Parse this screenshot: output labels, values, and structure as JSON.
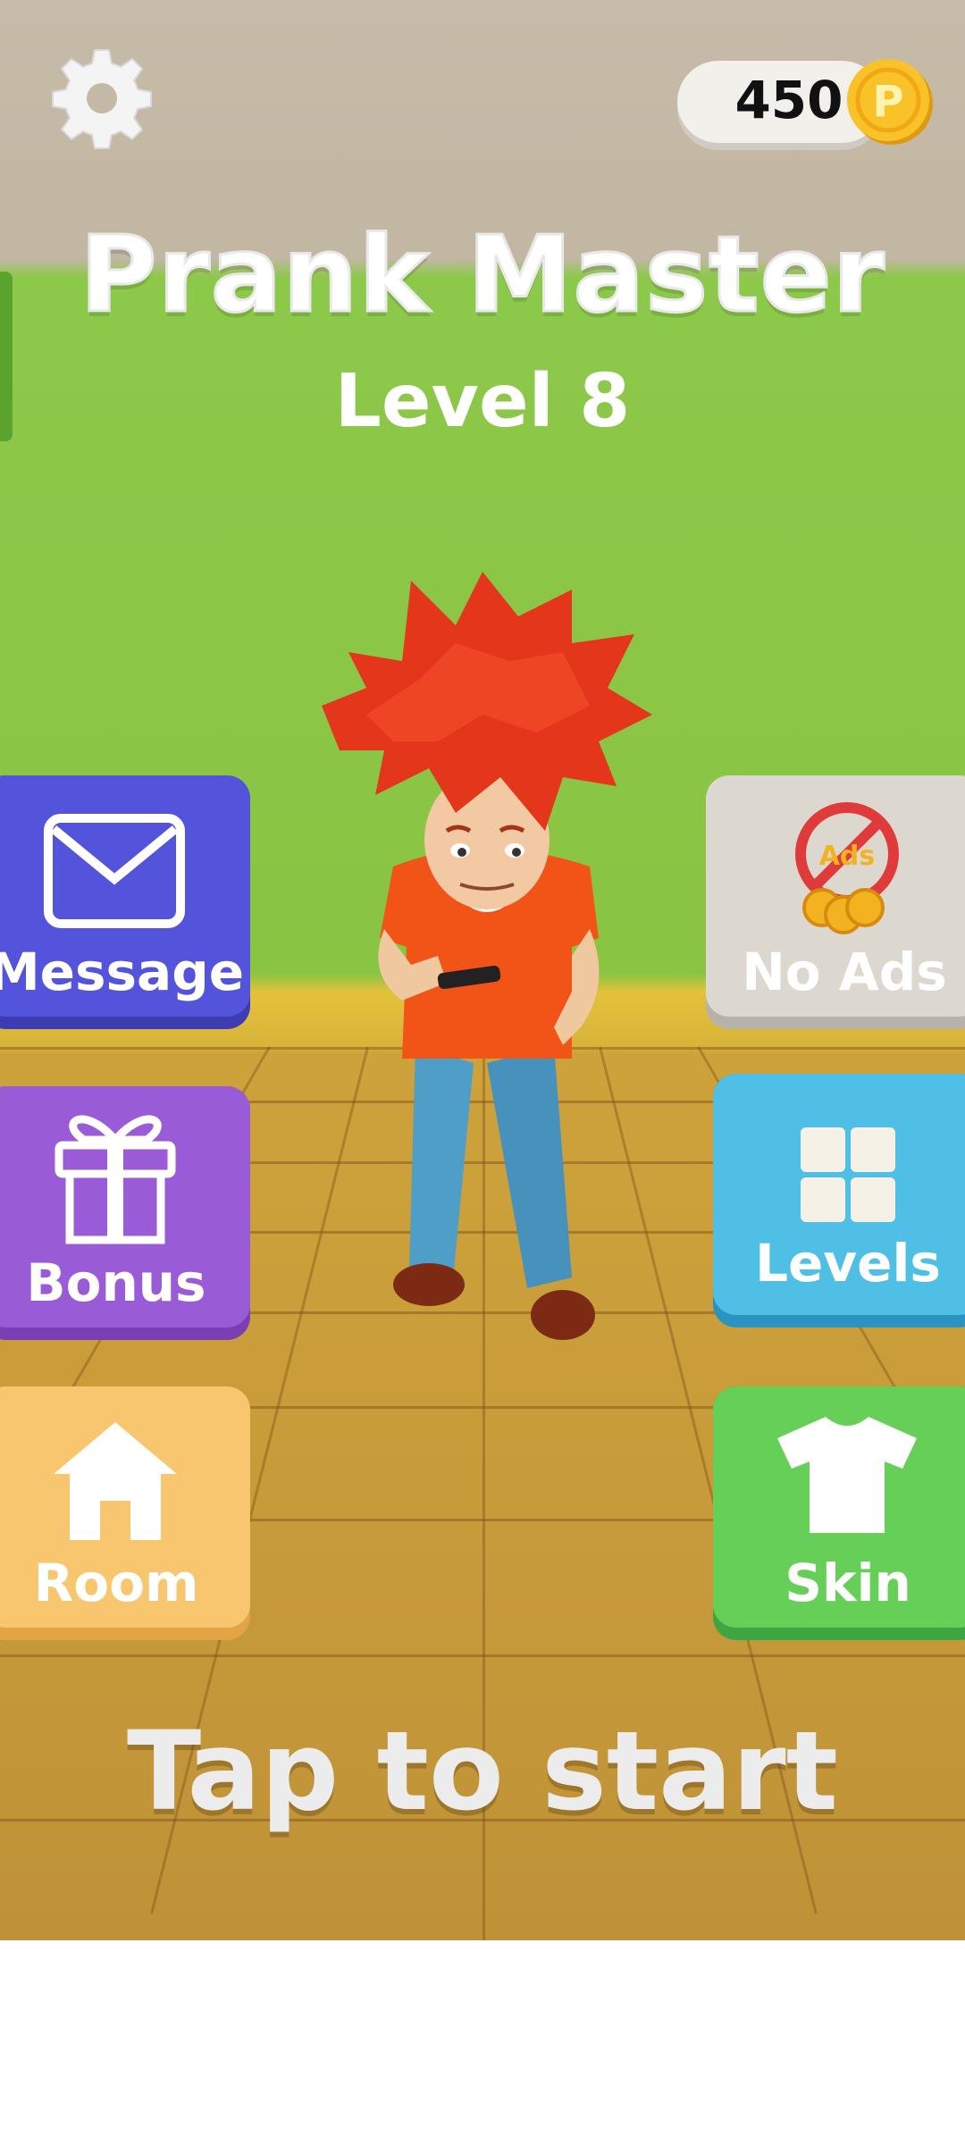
{
  "header": {
    "coin_count": "450",
    "coin_symbol": "P"
  },
  "title": {
    "app_name": "Prank Master",
    "level": "Level 8"
  },
  "left_buttons": [
    {
      "label": "Message",
      "icon": "envelope-icon"
    },
    {
      "label": "Bonus",
      "icon": "gift-icon"
    },
    {
      "label": "Room",
      "icon": "house-icon"
    }
  ],
  "right_buttons": [
    {
      "label": "No Ads",
      "icon": "no-ads-icon",
      "icon_text": "Ads"
    },
    {
      "label": "Levels",
      "icon": "grid-icon"
    },
    {
      "label": "Skin",
      "icon": "tshirt-icon"
    }
  ],
  "footer": {
    "prompt": "Tap to start"
  },
  "colors": {
    "wall": "#8ac443",
    "ceiling": "#c2b7a3",
    "floor": "#c99c3a",
    "message": "#5453db",
    "bonus": "#9a5bd6",
    "room": "#f8c66e",
    "no_ads": "#dcd8d0",
    "levels": "#4fbfe6",
    "skin": "#66cf57",
    "coin": "#f6b81a"
  }
}
